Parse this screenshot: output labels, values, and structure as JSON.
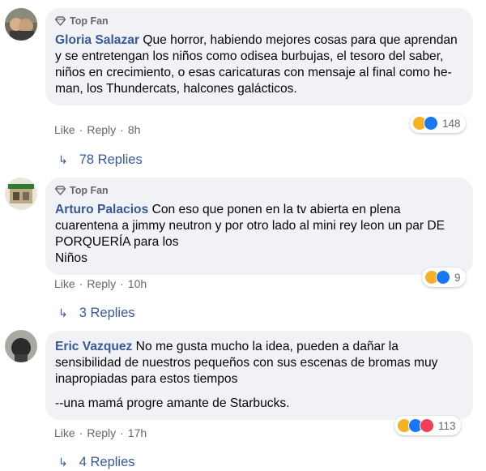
{
  "badge_label": "Top Fan",
  "comments": [
    {
      "author": "Gloria Salazar",
      "text": " Que horror, habiendo mejores cosas para que aprendan y se entretengan los niños como odisea burbujas, el tesoro del saber, niños en crecimiento, o esas caricaturas con mensaje al final como he-man, los Thundercats, halcones galácticos.",
      "top_fan": true,
      "like": "Like",
      "reply": "Reply",
      "time": "8h",
      "reaction_icons": [
        "haha-icon",
        "like-icon"
      ],
      "reaction_count": "148",
      "replies_label": "78 Replies"
    },
    {
      "author": "Arturo Palacios",
      "text_lines": [
        " Con eso que ponen en la tv abierta en plena cuarentena a jimmy neutron y por otro lado al mini rey leon un par DE PORQUERÍA para los",
        "Niños"
      ],
      "top_fan": true,
      "like": "Like",
      "reply": "Reply",
      "time": "10h",
      "reaction_icons": [
        "haha-icon",
        "like-icon"
      ],
      "reaction_count": "9",
      "replies_label": "3 Replies"
    },
    {
      "author": "Eric Vazquez",
      "text": " No me gusta mucho la idea, pueden a dañar la sensibilidad de nuestros pequeños con sus escenas de bromas muy inapropiadas para estos tiempos",
      "text2": "--una mamá progre amante de Starbucks.",
      "top_fan": false,
      "like": "Like",
      "reply": "Reply",
      "time": "17h",
      "reaction_icons": [
        "haha-icon",
        "like-icon",
        "love-icon"
      ],
      "reaction_count": "113",
      "replies_label": "4 Replies"
    }
  ],
  "colors": {
    "bubble": "#f0f2f5",
    "author": "#385898",
    "meta": "#65676b",
    "like_blue": "#1877f2",
    "haha_yellow": "#f7b125",
    "love_red": "#f33e58"
  }
}
